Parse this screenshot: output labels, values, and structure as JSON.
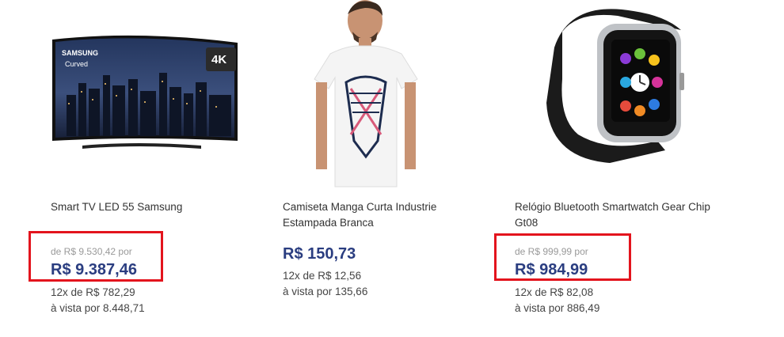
{
  "products": [
    {
      "name": "Smart TV LED 55 Samsung",
      "image_alt": "Samsung Curved 4K TV",
      "brand_text": "SAMSUNG",
      "curved_text": "Curved",
      "badge_text": "4K",
      "old_price": "de R$ 9.530,42 por",
      "price": "R$ 9.387,46",
      "installments": "12x de R$ 782,29",
      "cash_price": "à vista por 8.448,71",
      "highlighted": true
    },
    {
      "name": "Camiseta Manga Curta Industrie Estampada Branca",
      "image_alt": "Man wearing white printed t-shirt",
      "old_price": "",
      "price": "R$ 150,73",
      "installments": "12x de R$ 12,56",
      "cash_price": "à vista por 135,66",
      "highlighted": false
    },
    {
      "name": "Relógio Bluetooth Smartwatch Gear Chip Gt08",
      "image_alt": "Black smartwatch",
      "old_price": "de R$ 999,99 por",
      "price": "R$ 984,99",
      "installments": "12x de R$ 82,08",
      "cash_price": "à vista por 886,49",
      "highlighted": true
    }
  ],
  "colors": {
    "price": "#2a3d80",
    "highlight": "#e3141d",
    "muted": "#999999"
  }
}
